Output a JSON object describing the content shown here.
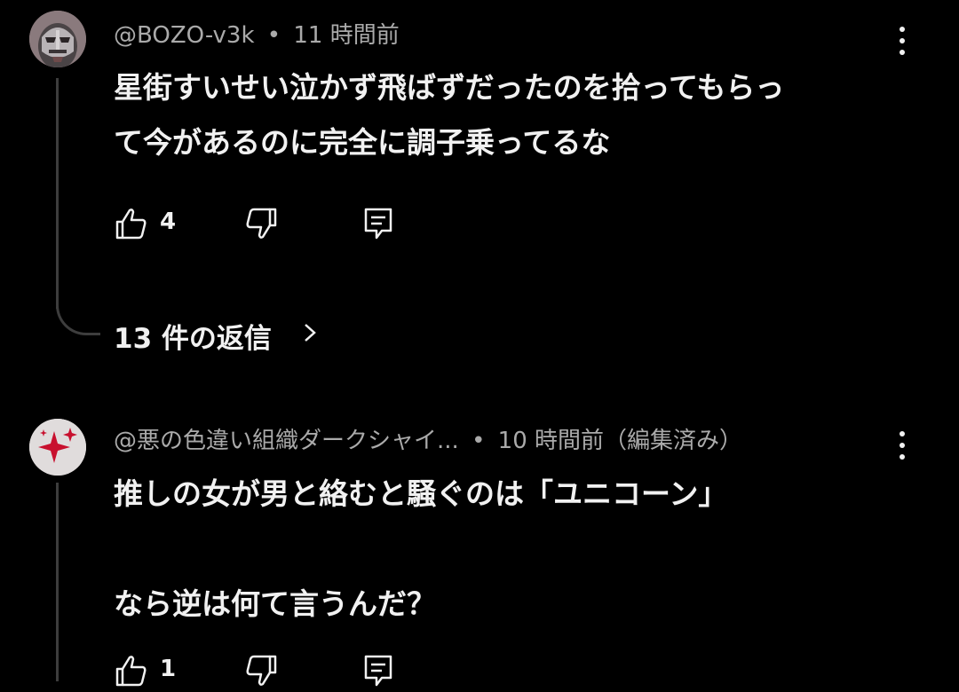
{
  "comments": [
    {
      "author": "@BOZO-v3k",
      "separator": "•",
      "time": "11 時間前",
      "lines": [
        "星街すいせい泣かず飛ばずだったのを拾ってもらっ",
        "て今があるのに完全に調子乗ってるな"
      ],
      "likes": "4",
      "replies_label": "13 件の返信",
      "avatar_icon": "metal-mask-avatar-icon"
    },
    {
      "author": "@悪の色違い組織ダークシャイ...",
      "separator": "•",
      "time": "10 時間前（編集済み）",
      "lines": [
        "推しの女が男と絡むと騒ぐのは「ユニコーン」",
        "",
        "なら逆は何て言うんだ？"
      ],
      "likes": "1",
      "avatar_icon": "red-sparkle-avatar-icon"
    }
  ],
  "icons": {
    "like": "thumbs-up-icon",
    "dislike": "thumbs-down-icon",
    "reply": "reply-comment-icon",
    "more": "more-vertical-icon",
    "chevron": "chevron-right-icon"
  },
  "colors": {
    "background": "#000000",
    "text_primary": "#f1f1f1",
    "text_secondary": "#aaaaaa",
    "thread_line": "#3d3d3d",
    "sparkle_red": "#c8102e"
  }
}
